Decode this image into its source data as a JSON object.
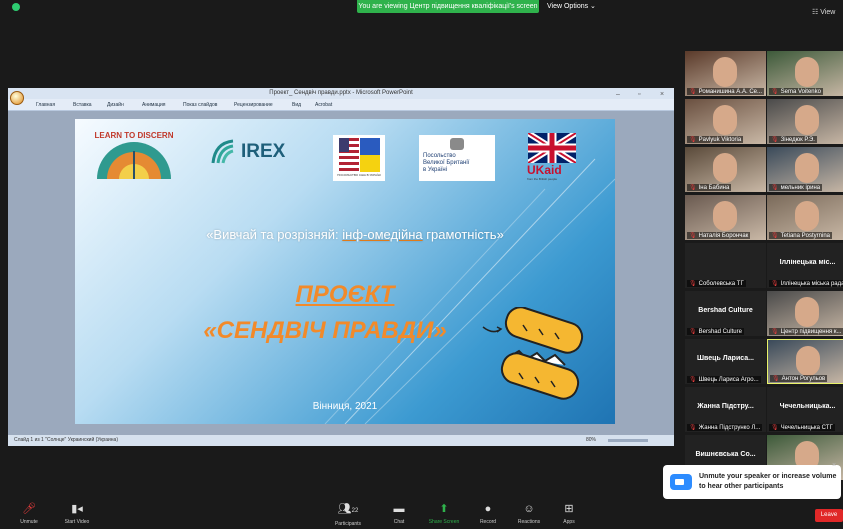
{
  "topbar": {
    "share_banner": "You are viewing Центр підвищення кваліфікації's screen",
    "view_options": "View Options ⌄",
    "view": "☷ View"
  },
  "ppt": {
    "window_title": "Проект_ Сендвіч правди.pptx - Microsoft PowerPoint",
    "tabs": [
      "Главная",
      "Вставка",
      "Дизайн",
      "Анимация",
      "Показ слайдов",
      "Рецензирование",
      "Вид",
      "Acrobat"
    ],
    "status": "Слайд 1 из 1    \"Солнце\"    Украинский (Украина)",
    "zoom": "80%"
  },
  "slide": {
    "logo_learn": "LEARN TO DISCERN",
    "logo_irex": "IREX",
    "logo_usa_caption": "ПОСОЛЬСТВО США В УКРАЇНІ",
    "logo_uk_lines": [
      "Посольство",
      "Великої Британії",
      "в Україні"
    ],
    "logo_ukaid": "UKaid",
    "logo_ukaid_caption": "from the British people",
    "subtitle_a": "«Вивчай та розрізняй: ",
    "subtitle_b": "інф-омедійна",
    "subtitle_c": " грамотність»",
    "title1": "ПРОЄКТ",
    "title2": "«СЕНДВІЧ ПРАВДИ»",
    "city": "Вінниця, 2021"
  },
  "gallery": [
    {
      "name": "Романишина А.А. Се...",
      "type": "video"
    },
    {
      "name": "Sema Voitenko",
      "type": "video"
    },
    {
      "name": "Pavlyuk Viktoria",
      "type": "video"
    },
    {
      "name": "Зінедюк Р.Э.",
      "type": "video"
    },
    {
      "name": "Іна Бабина",
      "type": "video"
    },
    {
      "name": "мельник ірина",
      "type": "video"
    },
    {
      "name": "Наталія Борончак",
      "type": "video"
    },
    {
      "name": "Tetiana Postyrnina",
      "type": "video"
    },
    {
      "name": "Соболевська ТГ",
      "type": "name",
      "big": ""
    },
    {
      "name": "Іллінецька міська рада",
      "type": "name",
      "big": "Іллінецька міс..."
    },
    {
      "name": "Bershad Culture",
      "type": "name",
      "big": "Bershad Culture"
    },
    {
      "name": "Центр підвищення к...",
      "type": "video"
    },
    {
      "name": "Швець Лариса Агро...",
      "type": "name",
      "big": "Швець Лариса..."
    },
    {
      "name": "Антон Рогульов",
      "type": "video"
    },
    {
      "name": "Жанна Підструнко Л...",
      "type": "name",
      "big": "Жанна Підстру..."
    },
    {
      "name": "Чечельницька СТГ",
      "type": "name",
      "big": "Чечельницька..."
    },
    {
      "name": "",
      "type": "name",
      "big": "Вишнєвська Со..."
    },
    {
      "name": "",
      "type": "video"
    }
  ],
  "toast": {
    "text": "Unmute your speaker or increase volume to hear other participants",
    "close": "×"
  },
  "toolbar": {
    "unmute": "Unmute",
    "start_video": "Start Video",
    "participants": "Participants",
    "participants_count": "22",
    "chat": "Chat",
    "share_screen": "Share Screen",
    "record": "Record",
    "reactions": "Reactions",
    "apps": "Apps",
    "leave": "Leave"
  },
  "colors": {
    "accent_green": "#2fb24c",
    "leave_red": "#e02828",
    "slide_orange": "#f28a2a",
    "zoom_blue": "#2d8cff"
  }
}
